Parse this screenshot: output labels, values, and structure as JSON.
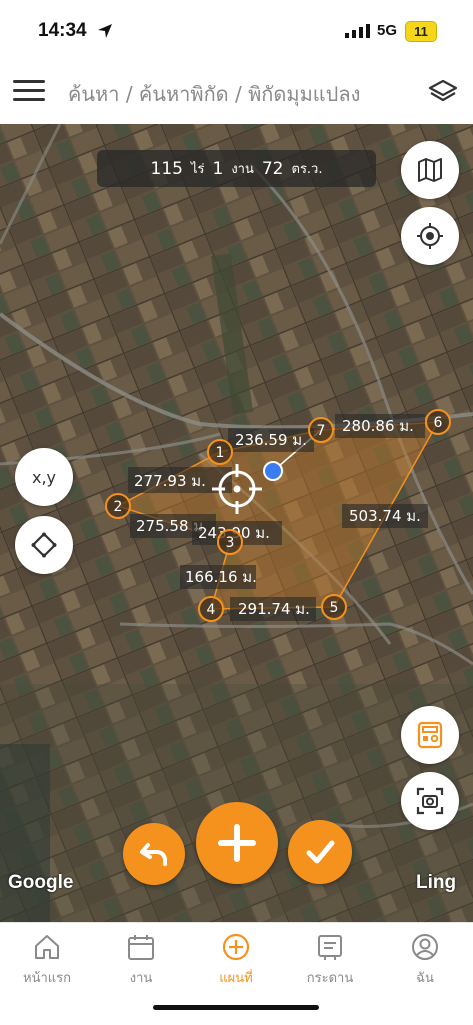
{
  "status_bar": {
    "time": "14:34",
    "network": "5G",
    "battery": "11"
  },
  "header": {
    "breadcrumb": "ค้นหา / ค้นหาพิกัด / พิกัดมุมแปลง"
  },
  "area": {
    "rai_value": "115",
    "rai_unit": "ไร่",
    "ngan_value": "1",
    "ngan_unit": "งาน",
    "wa_value": "72",
    "wa_unit": "ตร.ว."
  },
  "left_buttons": {
    "xy_label": "x,y"
  },
  "vertices": [
    {
      "label": "1"
    },
    {
      "label": "2"
    },
    {
      "label": "3"
    },
    {
      "label": "4"
    },
    {
      "label": "5"
    },
    {
      "label": "6"
    },
    {
      "label": "7"
    }
  ],
  "edge_lengths": {
    "e12": "277.93 ม.",
    "e23": "275.58 ม.",
    "e1_3": "243.90 ม.",
    "e34": "166.16 ม.",
    "e45": "291.74 ม.",
    "e56": "503.74 ม.",
    "e67": "280.86 ม.",
    "e71": "236.59 ม."
  },
  "map_attribution": {
    "google": "Google",
    "ling": "Ling"
  },
  "tabs": [
    {
      "label": "หน้าแรก",
      "icon": "home-icon"
    },
    {
      "label": "งาน",
      "icon": "calendar-icon"
    },
    {
      "label": "แผนที่",
      "icon": "plus-circle-icon"
    },
    {
      "label": "กระดาน",
      "icon": "board-icon"
    },
    {
      "label": "ฉัน",
      "icon": "user-icon"
    }
  ],
  "colors": {
    "accent": "#f5921e",
    "blue_dot": "#3a7df0"
  }
}
